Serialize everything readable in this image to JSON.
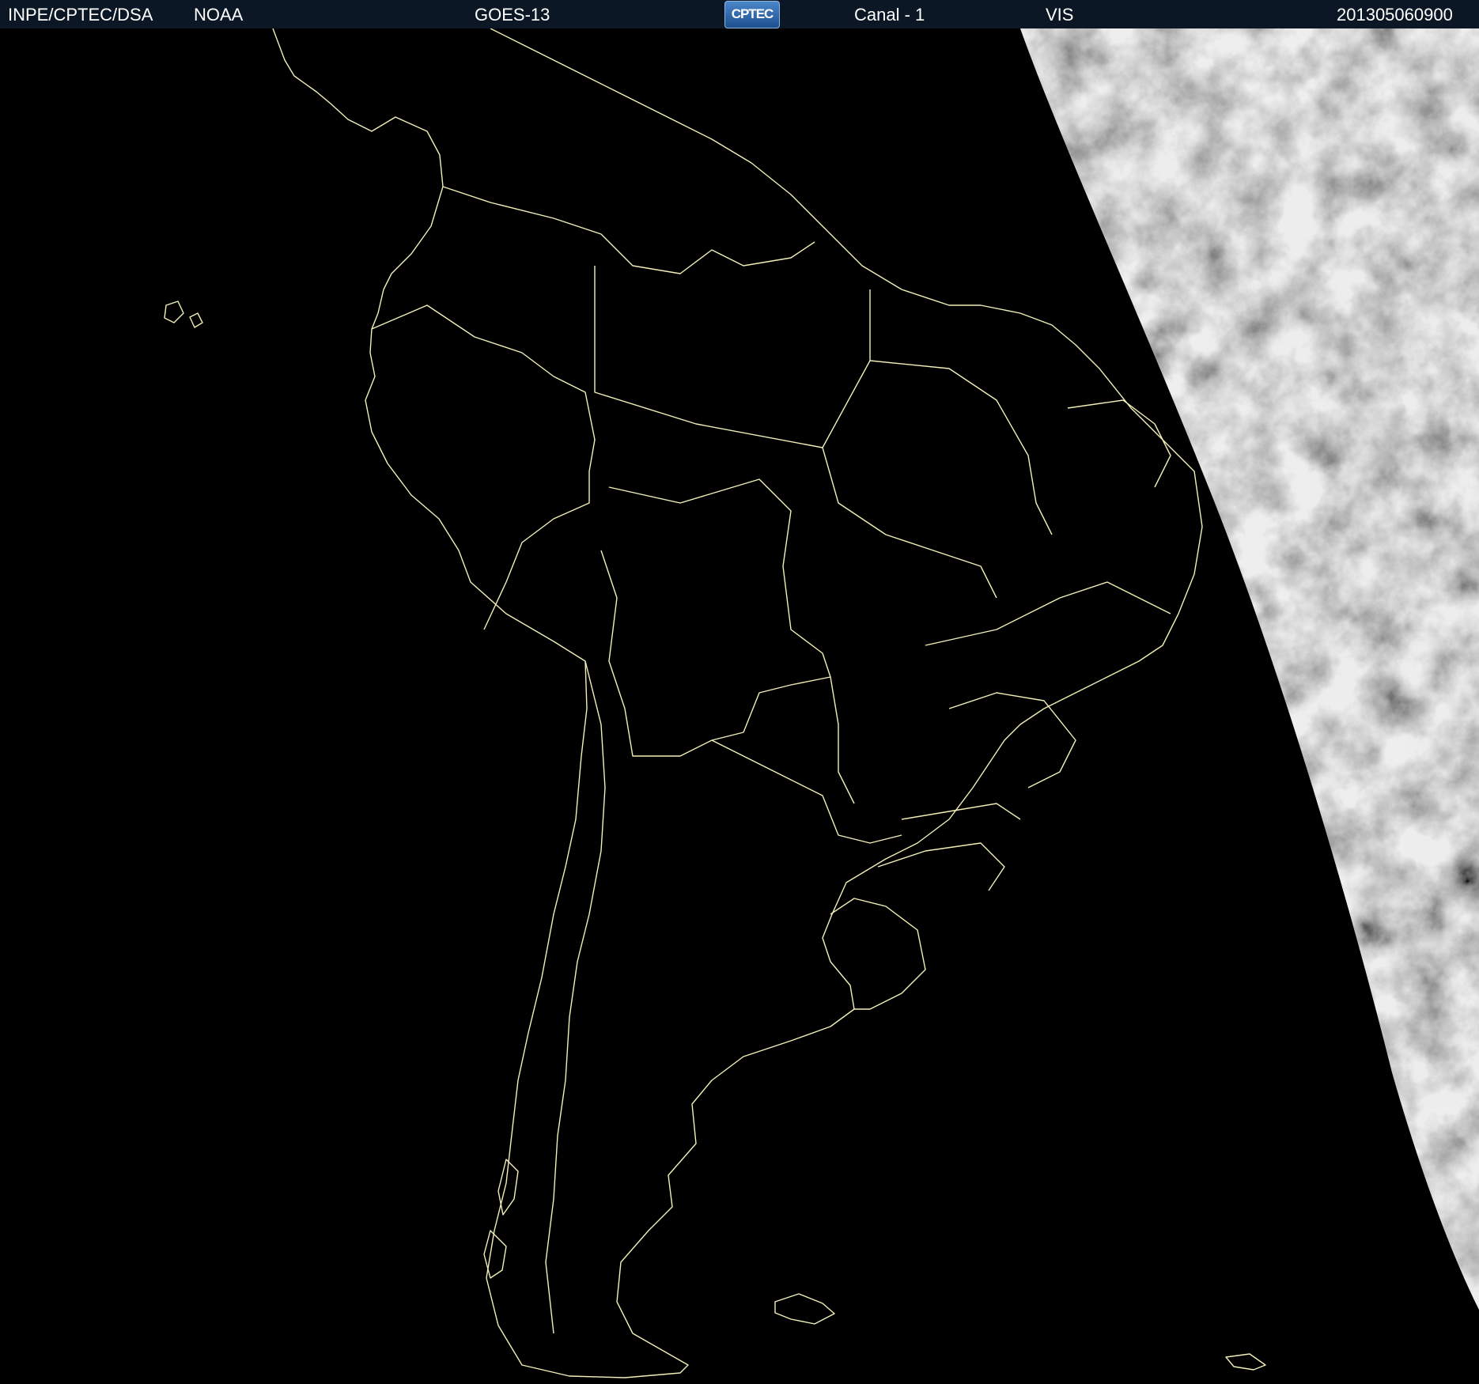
{
  "header": {
    "institution": "INPE/CPTEC/DSA",
    "agency": "NOAA",
    "satellite": "GOES-13",
    "logo_text": "CPTEC",
    "channel": "Canal - 1",
    "band": "VIS",
    "timestamp": "201305060900"
  },
  "colors": {
    "header_bg": "#0b1724",
    "background": "#000000",
    "boundary_lines": "#f2f0b8",
    "cloud_field": "#9a9a9a"
  },
  "icons": [
    "cptec-logo"
  ]
}
